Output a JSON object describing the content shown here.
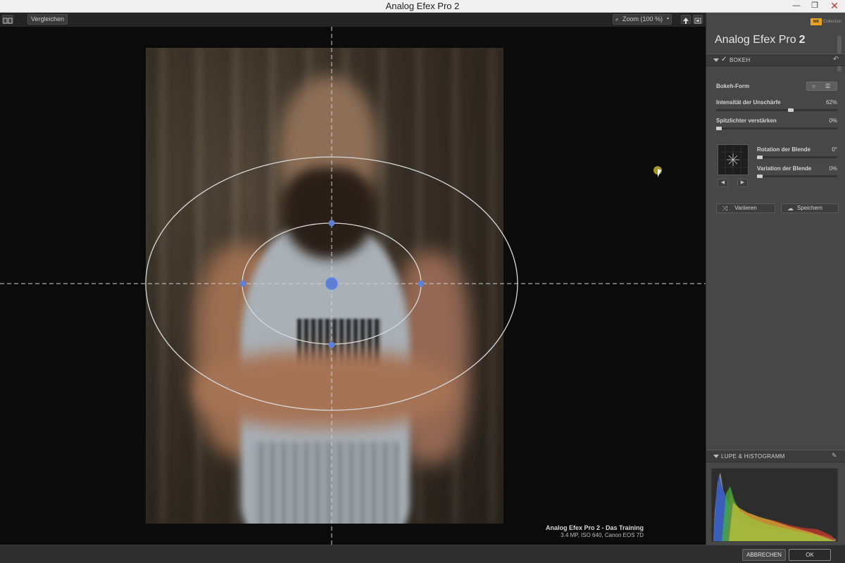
{
  "window": {
    "title": "Analog Efex Pro 2",
    "minimize_glyph": "—",
    "restore_glyph": "❐",
    "close_glyph": "✕"
  },
  "toolbar": {
    "compare_label": "Vergleichen",
    "zoom_label": "Zoom (100 %)"
  },
  "image_info": {
    "title": "Analog Efex Pro 2 - Das Training",
    "details": "3.4 MP, ISO 640, Canon EOS 7D"
  },
  "sidebar": {
    "brand_prefix": "Analog Efex Pro",
    "brand_version": "2",
    "logo_text": "NIK",
    "logo_sub": "Collection",
    "bokeh": {
      "header": "BOKEH",
      "enabled": true,
      "check_glyph": "✓",
      "reset_glyph": "↶",
      "shape_label": "Bokeh-Form",
      "shape_options": [
        "○",
        "☰"
      ],
      "intensity_label": "Intensität der Unschärfe",
      "intensity_value": "62%",
      "intensity_level": 0.62,
      "highlights_label": "Spitzlichter verstärken",
      "highlights_value": "0%",
      "highlights_level": 0,
      "rotation_label": "Rotation der Blende",
      "rotation_value": "0°",
      "rotation_level": 0,
      "variation_label": "Variation der Blende",
      "variation_value": "0%",
      "variation_level": 0,
      "prev_glyph": "◀",
      "next_glyph": "▶",
      "vary_label": "Variieren",
      "vary_icon": "⤨",
      "save_label": "Speichern",
      "save_icon": "☁"
    },
    "loupe": {
      "header": "LUPE & HISTOGRAMM",
      "pin_glyph": "✎"
    }
  },
  "footer": {
    "cancel_label": "ABBRECHEN",
    "ok_label": "OK"
  },
  "colors": {
    "accent_handle": "#5f7fd6",
    "guide": "#d0d0d0",
    "cursor_highlight": "#b9a22a"
  }
}
